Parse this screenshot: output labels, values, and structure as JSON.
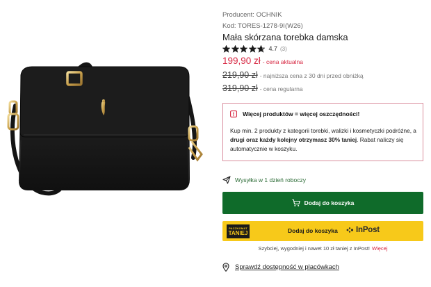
{
  "product": {
    "producer": "Producent: OCHNIK",
    "code": "Kod: TORES-1278-9I(W26)",
    "title": "Mała skórzana torebka damska",
    "image_icon": "black-leather-crossbody-bag"
  },
  "rating": {
    "stars": 4.7,
    "max": 5,
    "value": "4.7",
    "count": "(3)"
  },
  "prices": {
    "current": "199,90 zł",
    "current_note": "- cena aktualna",
    "lowest": "219,90 zł",
    "lowest_note": "- najniższa cena z 30 dni przed obniżką",
    "regular": "319,90 zł",
    "regular_note": "- cena regularna"
  },
  "promo": {
    "icon": "alert-icon",
    "title": "Więcej produktów = więcej oszczędności!",
    "line1": "Kup min. 2 produkty z kategorii torebki, walizki i kosmetyczki podróżne, a",
    "line2_bold": "drugi oraz każdy kolejny otrzymasz 30% taniej",
    "line2_rest": ". Rabat naliczy się",
    "line3": "automatycznie w koszyku."
  },
  "shipping": {
    "icon": "paper-plane-icon",
    "text": "Wysyłka w 1 dzień roboczy"
  },
  "cart": {
    "icon": "cart-icon",
    "label": "Dodaj do koszyka"
  },
  "inpost": {
    "badge_top": "PACZKOMAT",
    "badge_bottom": "TANIEJ",
    "label": "Dodaj do koszyka",
    "logo_text": "InPost",
    "note": "Szybciej, wygodniej i nawet 10 zł taniej z InPost!",
    "more": "Więcej"
  },
  "availability": {
    "icon": "map-pin-icon",
    "text": "Sprawdź dostępność w placówkach"
  },
  "colors": {
    "accent_red": "#d6243f",
    "cart_green": "#0f6b2a",
    "inpost_yellow": "#f7c91a",
    "promo_border": "#d98c9c",
    "shipping_green": "#2a6a34"
  }
}
